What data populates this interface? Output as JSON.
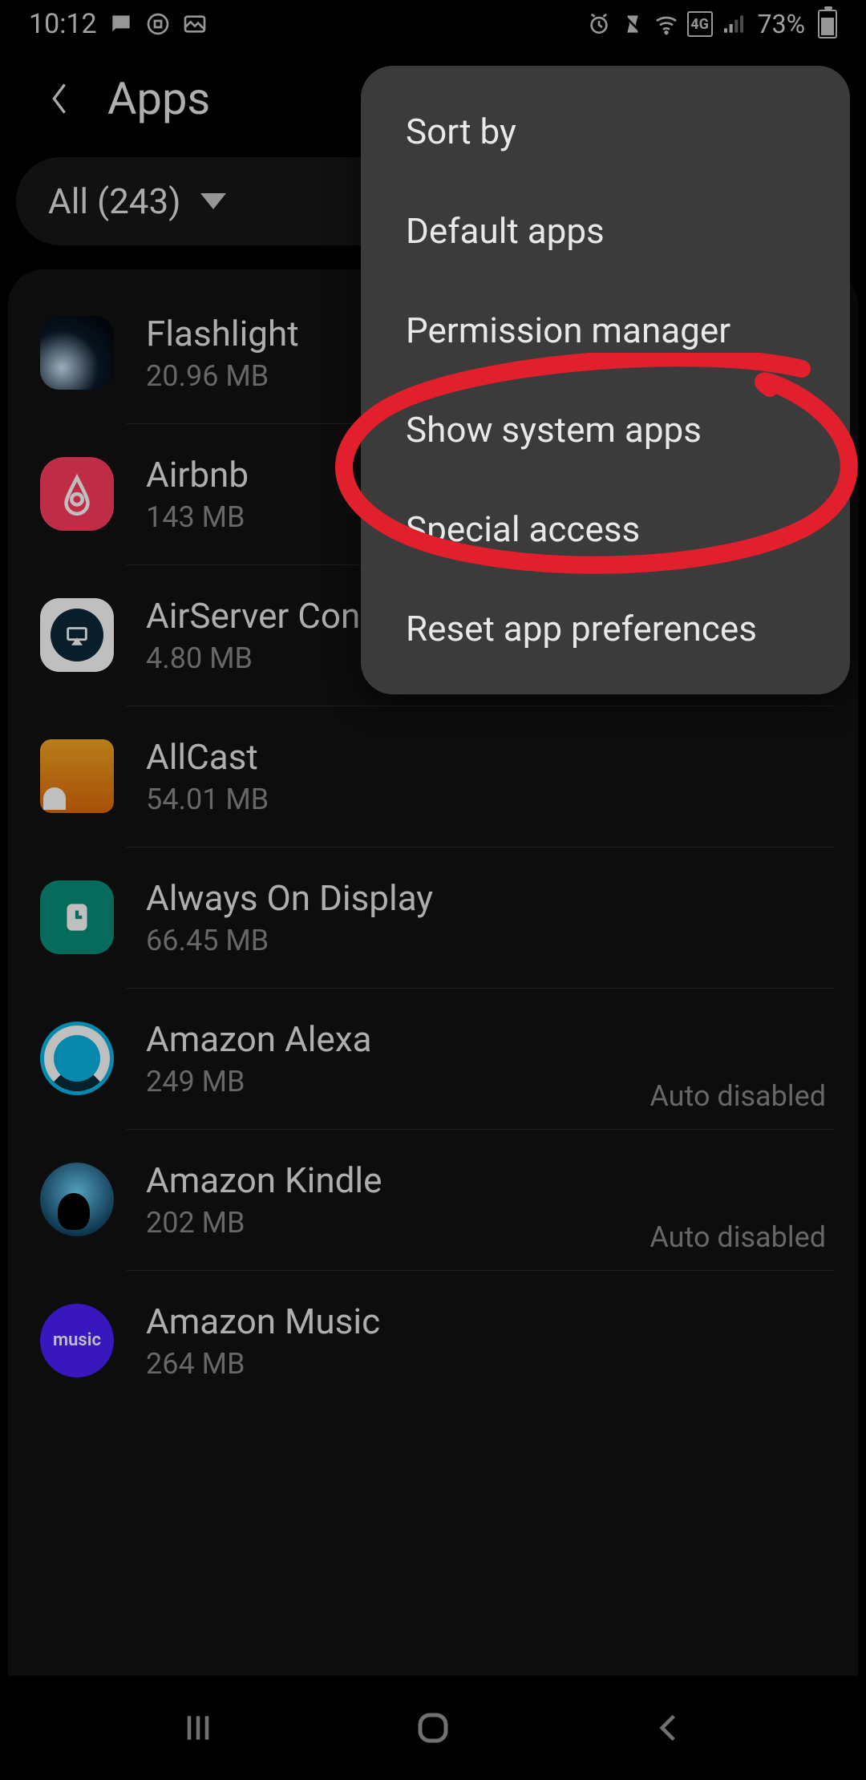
{
  "status": {
    "time": "10:12",
    "battery": "73%"
  },
  "header": {
    "title": "Apps"
  },
  "filter": {
    "label": "All (243)"
  },
  "apps": [
    {
      "name": "Flashlight",
      "size": "20.96 MB",
      "status": ""
    },
    {
      "name": "Airbnb",
      "size": "143 MB",
      "status": ""
    },
    {
      "name": "AirServer Connect",
      "size": "4.80 MB",
      "status": ""
    },
    {
      "name": "AllCast",
      "size": "54.01 MB",
      "status": ""
    },
    {
      "name": "Always On Display",
      "size": "66.45 MB",
      "status": ""
    },
    {
      "name": "Amazon Alexa",
      "size": "249 MB",
      "status": "Auto disabled"
    },
    {
      "name": "Amazon Kindle",
      "size": "202 MB",
      "status": "Auto disabled"
    },
    {
      "name": "Amazon Music",
      "size": "264 MB",
      "status": ""
    }
  ],
  "menu": {
    "items": [
      "Sort by",
      "Default apps",
      "Permission manager",
      "Show system apps",
      "Special access",
      "Reset app preferences"
    ],
    "highlighted_index": 3
  },
  "annotation": {
    "color": "#e21f2c"
  }
}
